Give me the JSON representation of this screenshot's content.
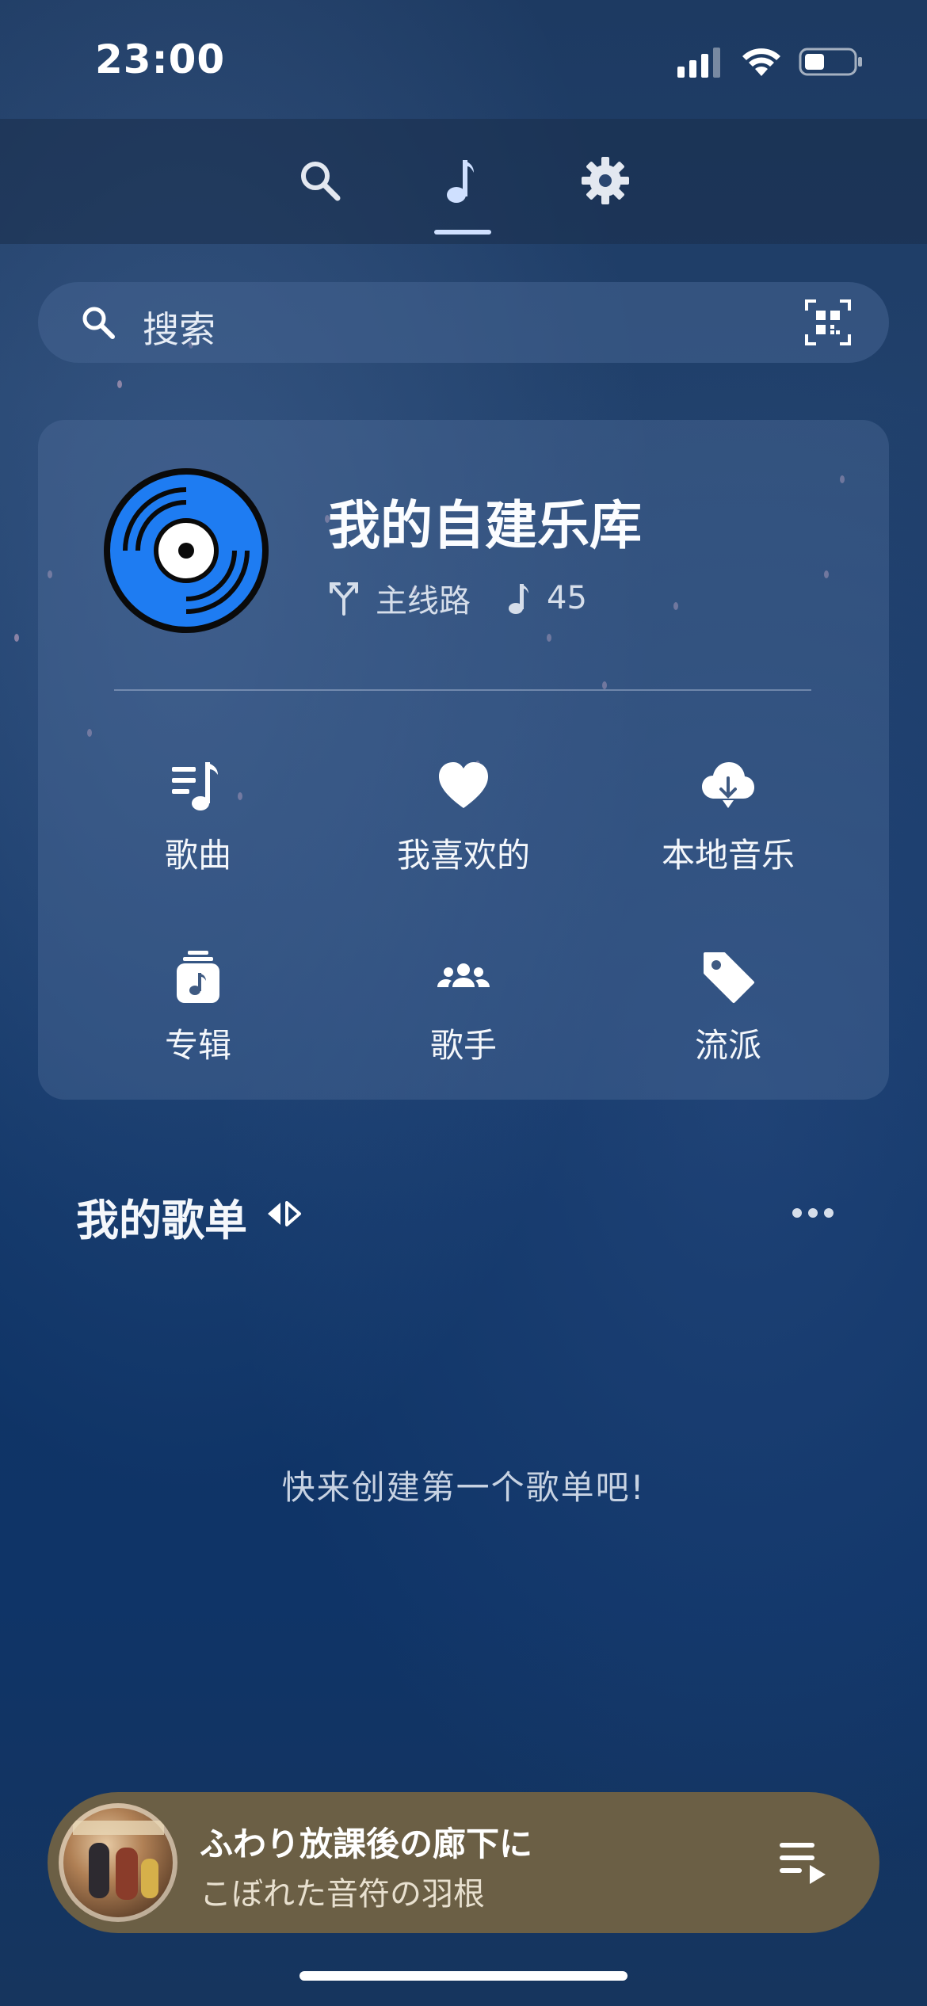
{
  "status_bar": {
    "time": "23:00"
  },
  "top_nav": {
    "tabs": [
      {
        "icon": "search-icon"
      },
      {
        "icon": "music-note-icon",
        "active": true
      },
      {
        "icon": "gear-icon"
      }
    ],
    "accent": "#cfe0ff"
  },
  "search": {
    "placeholder": "搜索",
    "scan_icon": "qr-code-icon"
  },
  "library": {
    "title": "我的自建乐库",
    "route_label": "主线路",
    "song_count": "45",
    "disc_color": "#1e7cf2",
    "items": [
      {
        "label": "歌曲",
        "icon": "song-list-icon"
      },
      {
        "label": "我喜欢的",
        "icon": "heart-icon"
      },
      {
        "label": "本地音乐",
        "icon": "cloud-download-icon"
      },
      {
        "label": "专辑",
        "icon": "album-icon"
      },
      {
        "label": "歌手",
        "icon": "artists-icon"
      },
      {
        "label": "流派",
        "icon": "tag-icon"
      }
    ]
  },
  "playlists": {
    "title": "我的歌单",
    "empty_text": "快来创建第一个歌单吧!"
  },
  "now_playing": {
    "title": "ふわり放課後の廊下に",
    "artist": "こぼれた音符の羽根",
    "background": "#6b5f45"
  }
}
